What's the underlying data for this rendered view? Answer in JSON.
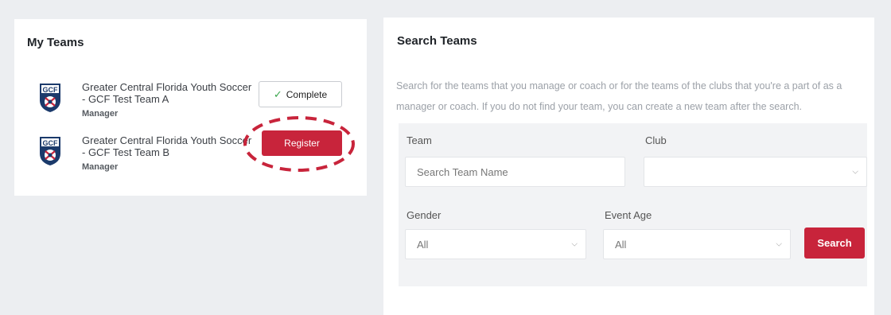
{
  "my_teams": {
    "title": "My Teams",
    "teams": [
      {
        "name": "Greater Central Florida Youth Soccer - GCF Test Team A",
        "role": "Manager",
        "action": "Complete",
        "status": "complete"
      },
      {
        "name": "Greater Central Florida Youth Soccer - GCF Test Team B",
        "role": "Manager",
        "action": "Register",
        "status": "register"
      }
    ],
    "logo_text": "GCF"
  },
  "search_teams": {
    "title": "Search Teams",
    "description": "Search for the teams that you manage or coach or for the teams of the clubs that you're a part of as a manager or coach. If you do not find your team, you can create a new team after the search.",
    "team_label": "Team",
    "team_placeholder": "Search Team Name",
    "club_label": "Club",
    "club_value": "",
    "gender_label": "Gender",
    "gender_value": "All",
    "event_age_label": "Event Age",
    "event_age_value": "All",
    "search_button": "Search"
  },
  "colors": {
    "accent": "#c8243b",
    "check": "#3aa64c",
    "background": "#eceef1"
  }
}
